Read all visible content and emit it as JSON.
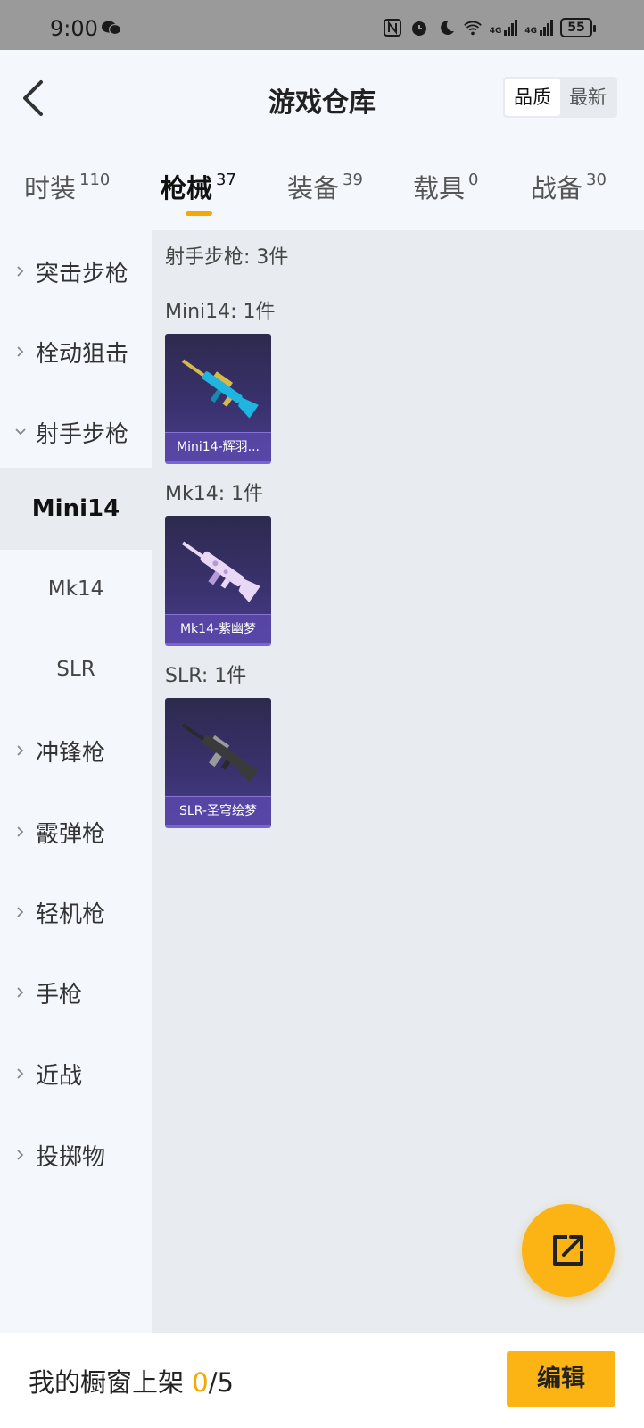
{
  "status_bar": {
    "time": "9:00",
    "battery": "55",
    "network_label_1": "4G",
    "network_label_2": "4G"
  },
  "header": {
    "title": "游戏仓库",
    "sort_options": [
      "品质",
      "最新"
    ],
    "sort_active": "品质"
  },
  "tabs": [
    {
      "label": "时装",
      "count": "110"
    },
    {
      "label": "枪械",
      "count": "37"
    },
    {
      "label": "装备",
      "count": "39"
    },
    {
      "label": "载具",
      "count": "0"
    },
    {
      "label": "战备",
      "count": "30"
    }
  ],
  "active_tab": "枪械",
  "sidebar": {
    "categories": [
      {
        "label": "突击步枪",
        "expanded": false
      },
      {
        "label": "栓动狙击",
        "expanded": false
      },
      {
        "label": "射手步枪",
        "expanded": true
      },
      {
        "label": "冲锋枪",
        "expanded": false
      },
      {
        "label": "霰弹枪",
        "expanded": false
      },
      {
        "label": "轻机枪",
        "expanded": false
      },
      {
        "label": "手枪",
        "expanded": false
      },
      {
        "label": "近战",
        "expanded": false
      },
      {
        "label": "投掷物",
        "expanded": false
      }
    ],
    "subitems": [
      "Mini14",
      "Mk14",
      "SLR"
    ],
    "active_subitem": "Mini14"
  },
  "content": {
    "section_title": "射手步枪: 3件",
    "groups": [
      {
        "title": "Mini14: 1件",
        "item_name": "Mini14-辉羽...",
        "colors": [
          "#1fb5e0",
          "#d7b84a"
        ]
      },
      {
        "title": "Mk14: 1件",
        "item_name": "Mk14-紫幽梦",
        "colors": [
          "#e8d8f5",
          "#b79ad8"
        ]
      },
      {
        "title": "SLR: 1件",
        "item_name": "SLR-圣穹绘梦",
        "colors": [
          "#3a3a3a",
          "#9a9a9a"
        ]
      }
    ]
  },
  "bottom_bar": {
    "showcase_label": "我的橱窗上架",
    "showcase_current": "0",
    "showcase_total": "/5",
    "edit_label": "编辑"
  },
  "colors": {
    "accent": "#fbb414",
    "card_bg": "#3a3270",
    "card_border": "#7a63d6"
  }
}
